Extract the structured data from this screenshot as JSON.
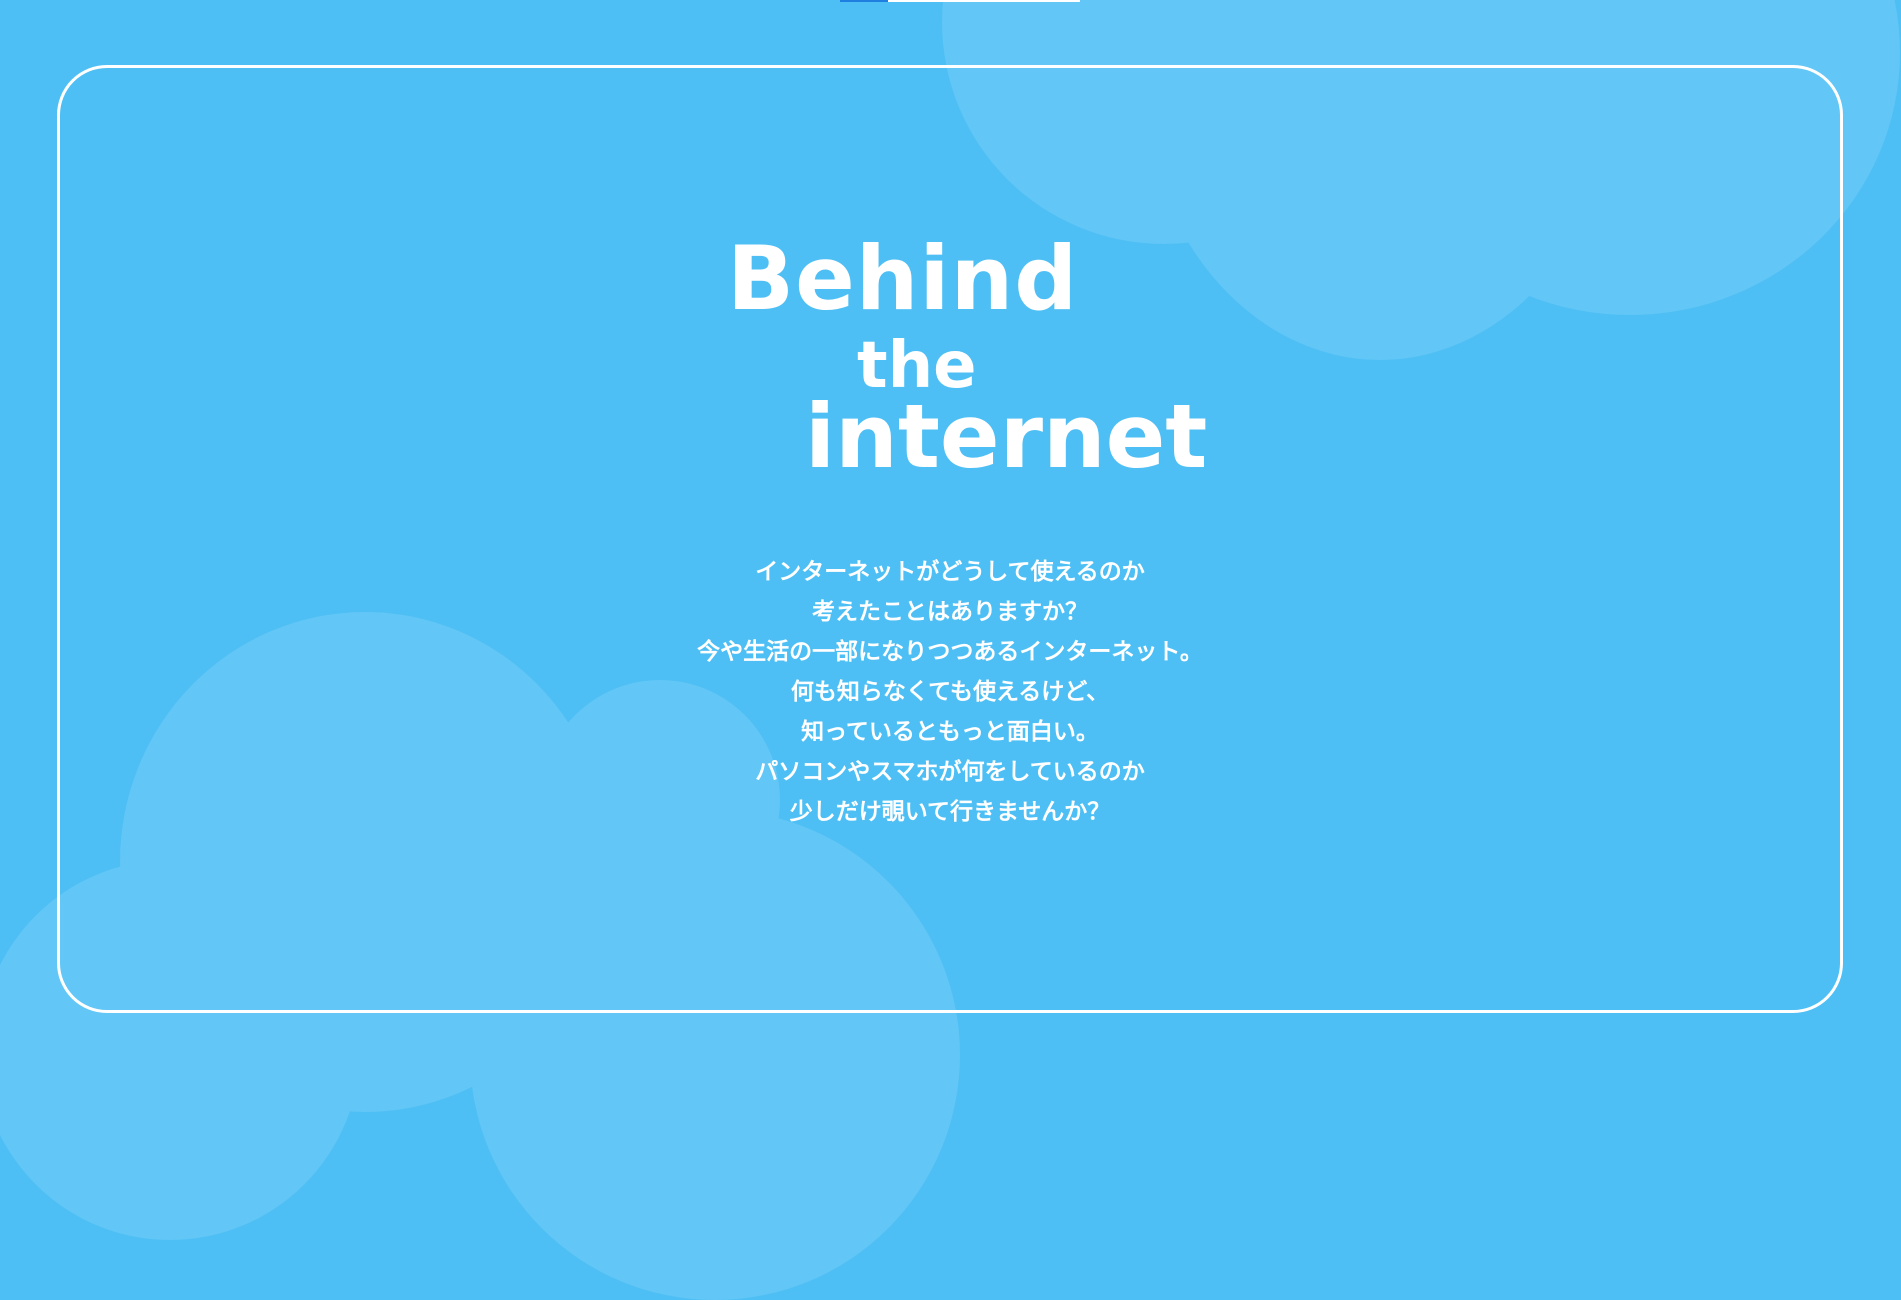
{
  "page": {
    "background_color": "#4ebff4",
    "cloud_color": "#62c6f6",
    "accent_color": "#1f7fe0"
  },
  "progress": {
    "value_percent": 20
  },
  "logo": {
    "line1": "Behind",
    "line2": "the",
    "line3": "internet"
  },
  "intro": {
    "lines": [
      "インターネットがどうして使えるのか",
      "考えたことはありますか？",
      "今や生活の一部になりつつあるインターネット。",
      "何も知らなくても使えるけど、",
      "知っているともっと面白い。",
      "パソコンやスマホが何をしているのか",
      "少しだけ覗いて行きませんか？"
    ]
  }
}
